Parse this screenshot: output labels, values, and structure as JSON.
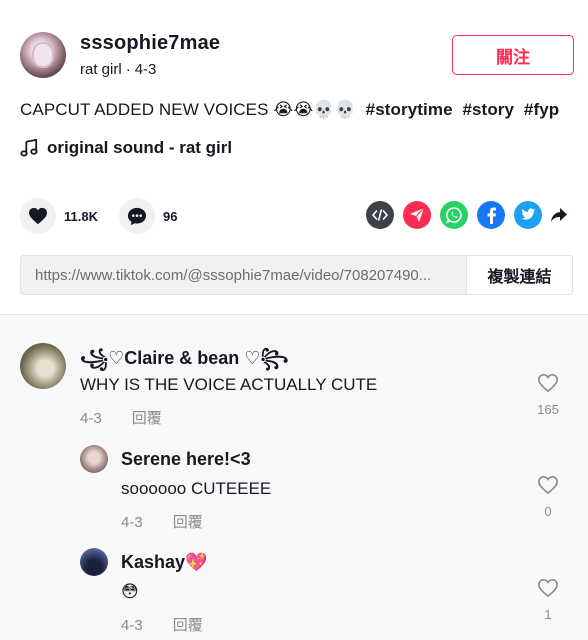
{
  "post": {
    "username": "sssophie7mae",
    "nickname": "rat girl",
    "date": "4-3",
    "follow_label": "關注",
    "caption_text": "CAPCUT ADDED NEW VOICES 😭😭💀💀",
    "hashtags": [
      "#storytime",
      "#story",
      "#fyp"
    ],
    "sound": "original sound - rat girl",
    "like_count": "11.8K",
    "comment_count": "96",
    "url": "https://www.tiktok.com/@sssophie7mae/video/708207490...",
    "copy_link_label": "複製連結",
    "colors": {
      "accent": "#fe2c55",
      "embed": "#3d4046",
      "send": "#fe2c55",
      "whatsapp": "#25d366",
      "facebook": "#1877f2",
      "twitter": "#1da1f2"
    }
  },
  "comments": [
    {
      "name": "꧁♡Claire & bean ♡꧂",
      "text": "WHY IS THE VOICE ACTUALLY CUTE",
      "date": "4-3",
      "reply_label": "回覆",
      "likes": "165"
    },
    {
      "name": "Serene here!<3",
      "text": "soooooo CUTEEEE",
      "date": "4-3",
      "reply_label": "回覆",
      "likes": "0"
    },
    {
      "name": "Kashay💖",
      "text": "😳",
      "date": "4-3",
      "reply_label": "回覆",
      "likes": "1"
    }
  ]
}
